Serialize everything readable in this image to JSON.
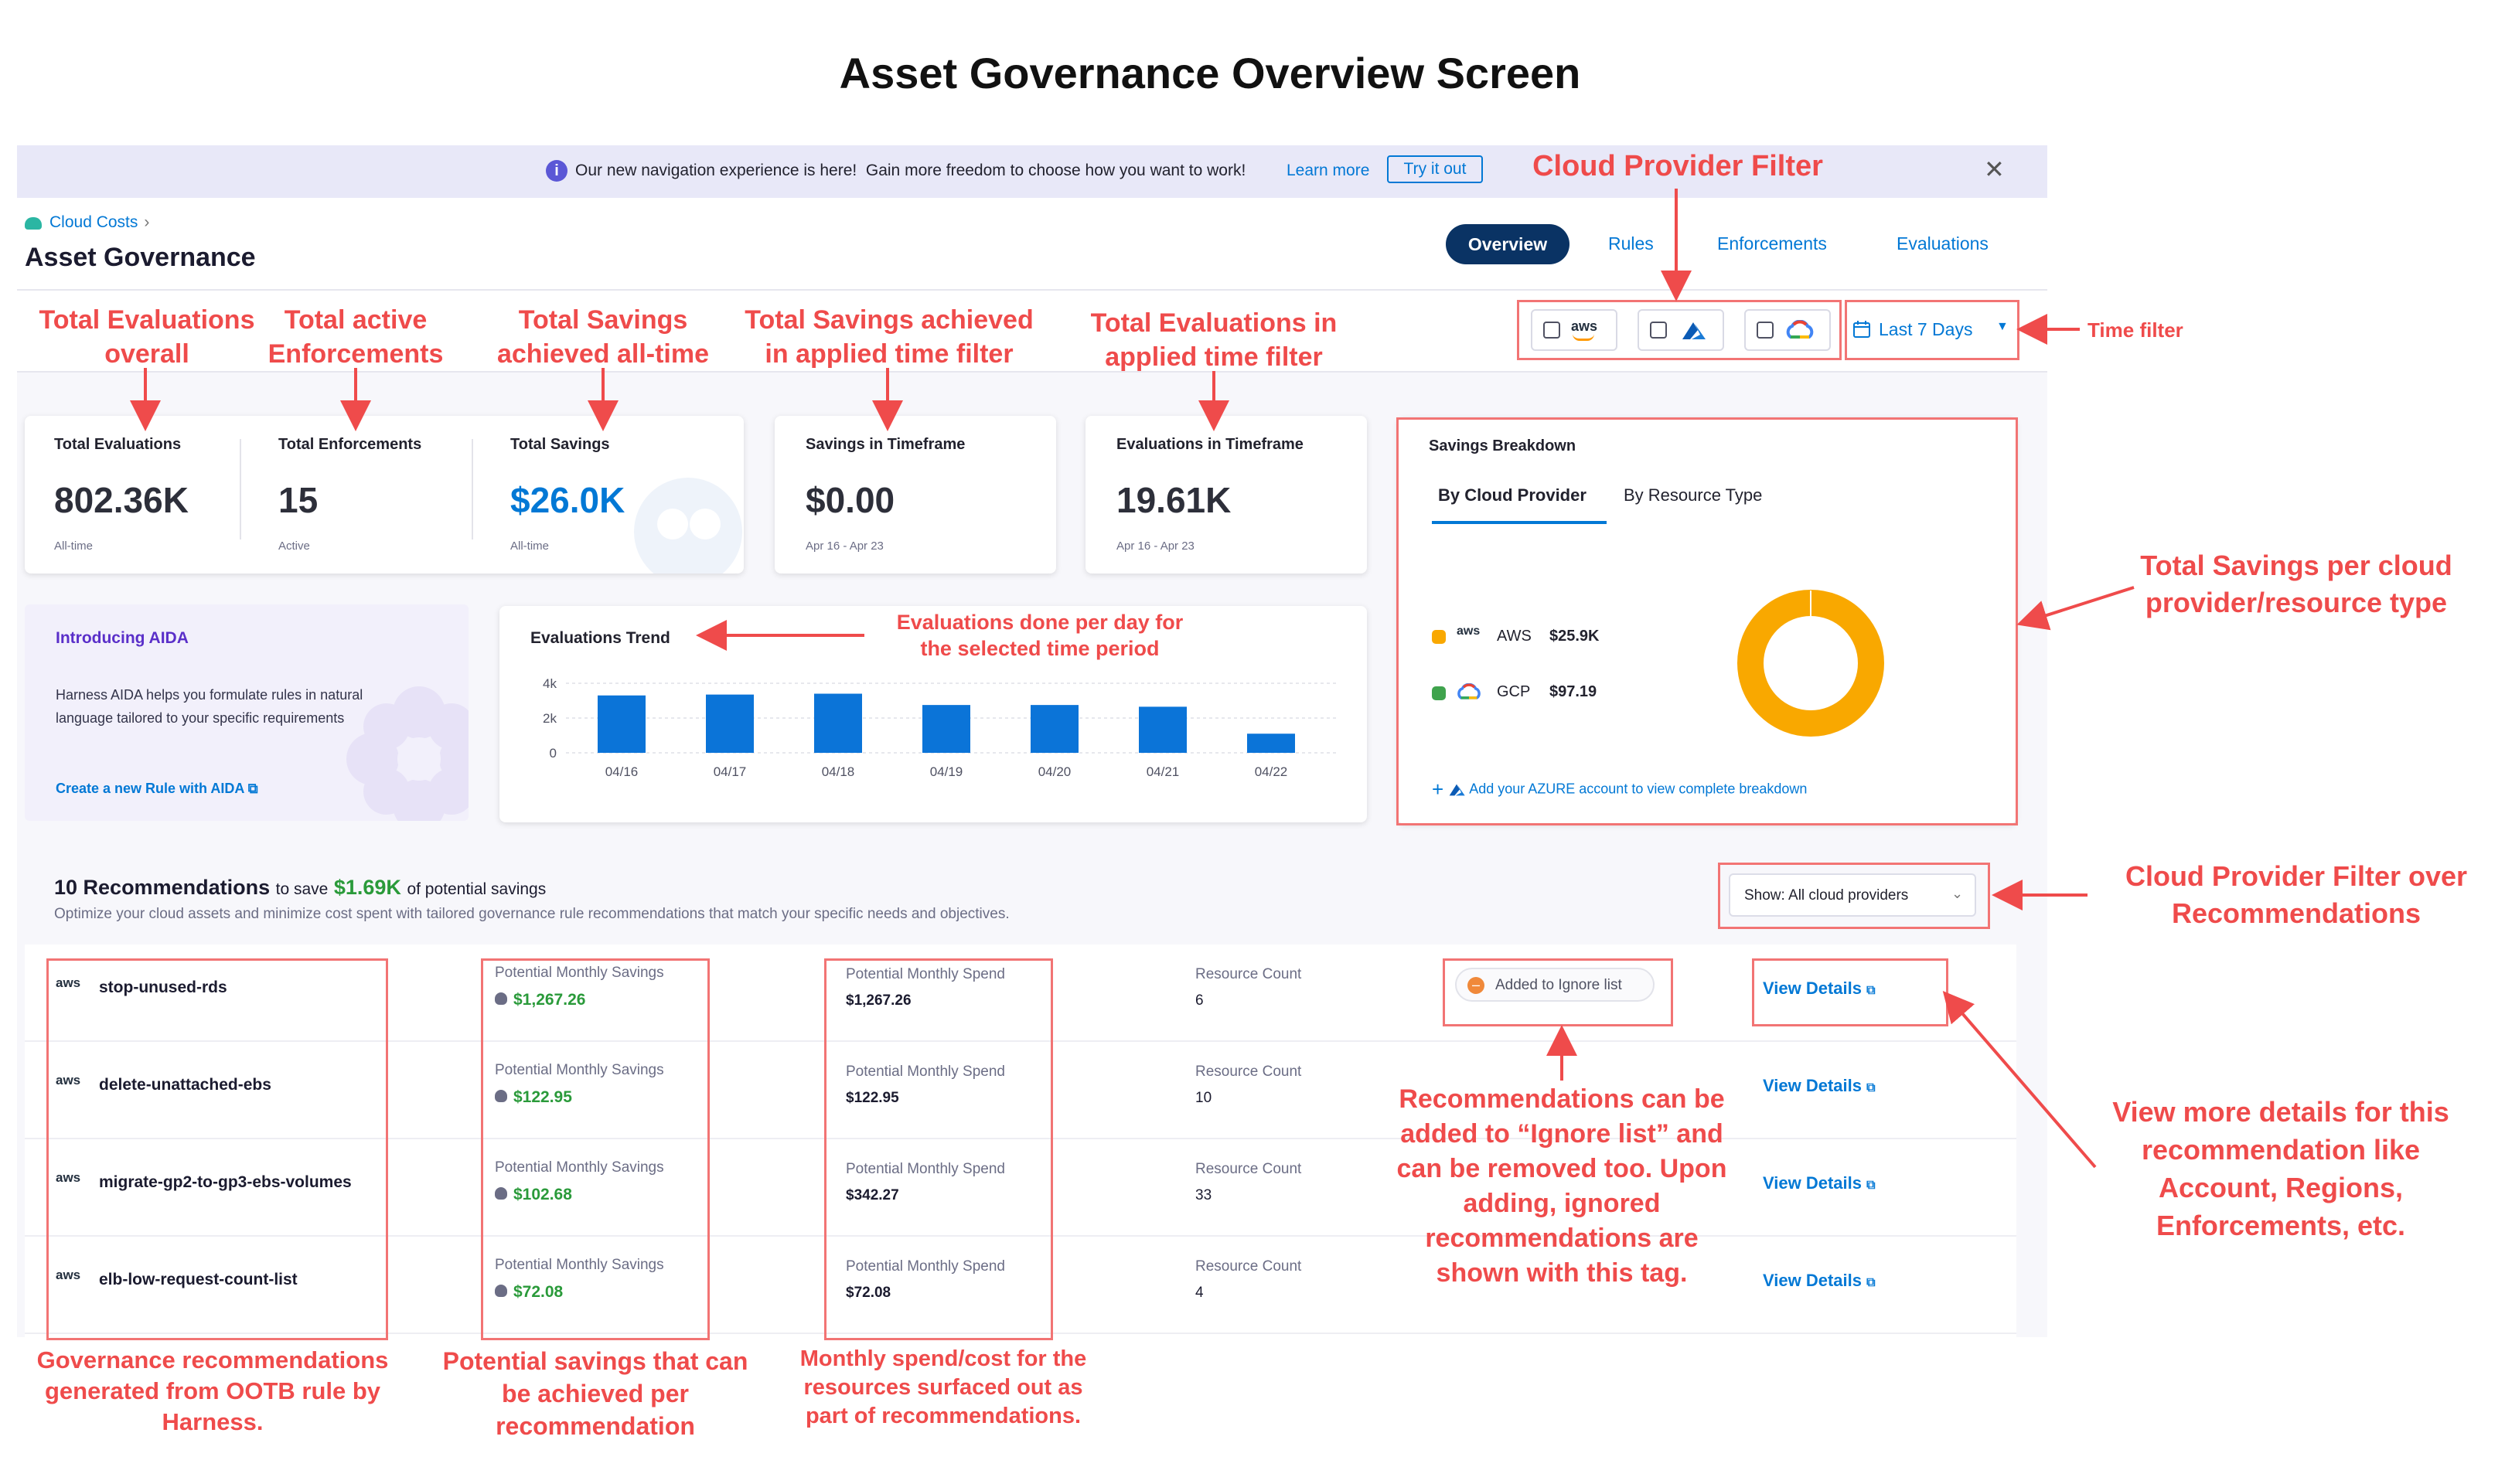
{
  "page_title": "Asset Governance Overview Screen",
  "banner": {
    "message": "Our new navigation experience is here!  Gain more freedom to choose how you want to work!",
    "learn_more": "Learn more",
    "try_it": "Try it out"
  },
  "breadcrumb": "Cloud Costs",
  "heading": "Asset Governance",
  "tabs": [
    "Overview",
    "Rules",
    "Enforcements",
    "Evaluations"
  ],
  "filters": {
    "aws_label": "aws",
    "time_filter": "Last 7 Days"
  },
  "stats": {
    "total_evaluations": {
      "label": "Total Evaluations",
      "value": "802.36K",
      "sub": "All-time"
    },
    "total_enforcements": {
      "label": "Total Enforcements",
      "value": "15",
      "sub": "Active"
    },
    "total_savings": {
      "label": "Total Savings",
      "value": "$26.0K",
      "sub": "All-time"
    },
    "savings_timeframe": {
      "label": "Savings in Timeframe",
      "value": "$0.00",
      "sub": "Apr 16 - Apr 23"
    },
    "evaluations_timeframe": {
      "label": "Evaluations in Timeframe",
      "value": "19.61K",
      "sub": "Apr 16 - Apr 23"
    }
  },
  "breakdown": {
    "title": "Savings Breakdown",
    "tab_provider": "By Cloud Provider",
    "tab_resource": "By Resource Type",
    "aws_icon_text": "aws",
    "aws_name": "AWS",
    "aws_value": "$25.9K",
    "gcp_name": "GCP",
    "gcp_value": "$97.19",
    "add_azure": "Add your AZURE account to view complete breakdown"
  },
  "aida": {
    "title": "Introducing AIDA",
    "text": "Harness AIDA helps you formulate rules in natural language tailored to your specific requirements",
    "link": "Create a new Rule with AIDA"
  },
  "chart_data": {
    "type": "bar",
    "title": "Evaluations Trend",
    "categories": [
      "04/16",
      "04/17",
      "04/18",
      "04/19",
      "04/20",
      "04/21",
      "04/22"
    ],
    "values": [
      3300,
      3350,
      3400,
      2750,
      2750,
      2650,
      1100
    ],
    "yticks": [
      "4k",
      "2k",
      "0"
    ],
    "ylim": [
      0,
      4000
    ],
    "grid": true,
    "colors": {
      "bar": "#0b74d8"
    }
  },
  "recommendations": {
    "title_count": "10 Recommendations",
    "title_mid": "to save",
    "title_amount": "$1.69K",
    "title_end": "of potential savings",
    "subtitle": "Optimize your cloud assets and minimize cost spent with tailored governance rule recommendations that match your specific needs and objectives.",
    "filter": "Show: All cloud providers",
    "savings_label": "Potential Monthly Savings",
    "spend_label": "Potential Monthly Spend",
    "count_label": "Resource Count",
    "ignore_tag": "Added to Ignore list",
    "view_details": "View Details",
    "aws_icon_text": "aws",
    "rows": [
      {
        "name": "stop-unused-rds",
        "savings": "$1,267.26",
        "spend": "$1,267.26",
        "count": "6"
      },
      {
        "name": "delete-unattached-ebs",
        "savings": "$122.95",
        "spend": "$122.95",
        "count": "10"
      },
      {
        "name": "migrate-gp2-to-gp3-ebs-volumes",
        "savings": "$102.68",
        "spend": "$342.27",
        "count": "33"
      },
      {
        "name": "elb-low-request-count-list",
        "savings": "$72.08",
        "spend": "$72.08",
        "count": "4"
      }
    ]
  },
  "annotations": {
    "cloud_provider_filter": "Cloud Provider Filter",
    "time_filter": "Time filter",
    "total_evaluations": "Total Evaluations overall",
    "total_enforcements": "Total active Enforcements",
    "total_savings": "Total Savings achieved all-time",
    "savings_timeframe": "Total Savings achieved in applied time filter",
    "evaluations_timeframe": "Total Evaluations in applied time filter",
    "evaluations_per_day": "Evaluations done per day for the selected time period",
    "savings_per_provider": "Total Savings per cloud provider/resource type",
    "rec_filter": "Cloud Provider Filter over Recommendations",
    "ignore_list": "Recommendations can be added to “Ignore list” and can be removed too. Upon adding, ignored recommendations are shown with this tag.",
    "view_more": "View more details for this recommendation like Account, Regions, Enforcements, etc.",
    "governance_recs": "Governance recommendations generated from OOTB rule by Harness.",
    "potential_savings": "Potential savings that can be achieved per recommendation",
    "monthly_spend": "Monthly spend/cost for the resources surfaced out as part of recommendations."
  },
  "colors": {
    "accent": "#0278d5",
    "annotation": "#ef4b4b",
    "savings_green": "#2a9a3a",
    "aws_donut": "#f9a800",
    "gcp_green": "#3fa34d"
  }
}
